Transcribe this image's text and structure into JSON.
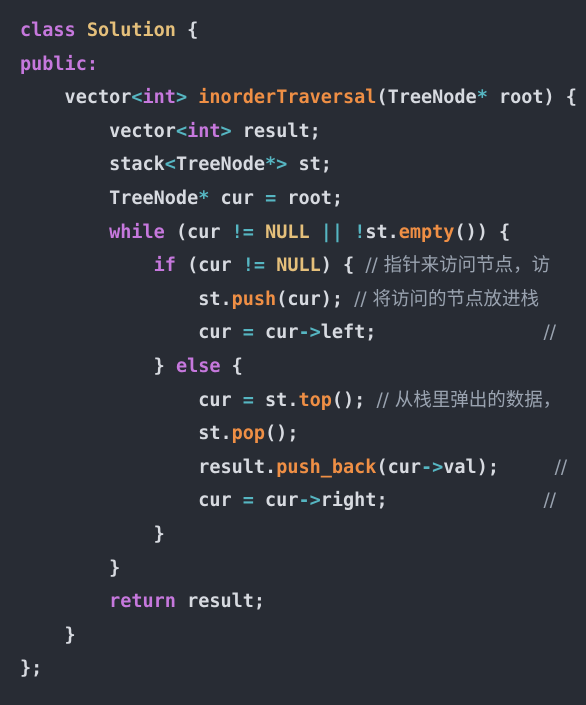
{
  "code_lines": [
    [
      {
        "t": "class ",
        "c": "kw"
      },
      {
        "t": "Solution",
        "c": "ty"
      },
      {
        "t": " {",
        "c": "pl"
      }
    ],
    [
      {
        "t": "public:",
        "c": "kw"
      }
    ],
    [
      {
        "t": "    vector",
        "c": "pl"
      },
      {
        "t": "<",
        "c": "op"
      },
      {
        "t": "int",
        "c": "kw"
      },
      {
        "t": ">",
        "c": "op"
      },
      {
        "t": " ",
        "c": "pl"
      },
      {
        "t": "inorderTraversal",
        "c": "fn"
      },
      {
        "t": "(TreeNode",
        "c": "pl"
      },
      {
        "t": "*",
        "c": "op"
      },
      {
        "t": " root) {",
        "c": "pl"
      }
    ],
    [
      {
        "t": "        vector",
        "c": "pl"
      },
      {
        "t": "<",
        "c": "op"
      },
      {
        "t": "int",
        "c": "kw"
      },
      {
        "t": ">",
        "c": "op"
      },
      {
        "t": " result;",
        "c": "pl"
      }
    ],
    [
      {
        "t": "        stack",
        "c": "pl"
      },
      {
        "t": "<",
        "c": "op"
      },
      {
        "t": "TreeNode",
        "c": "pl"
      },
      {
        "t": "*>",
        "c": "op"
      },
      {
        "t": " st;",
        "c": "pl"
      }
    ],
    [
      {
        "t": "        TreeNode",
        "c": "pl"
      },
      {
        "t": "*",
        "c": "op"
      },
      {
        "t": " cur ",
        "c": "pl"
      },
      {
        "t": "=",
        "c": "op"
      },
      {
        "t": " root;",
        "c": "pl"
      }
    ],
    [
      {
        "t": "        ",
        "c": "pl"
      },
      {
        "t": "while",
        "c": "kw"
      },
      {
        "t": " (cur ",
        "c": "pl"
      },
      {
        "t": "!=",
        "c": "op"
      },
      {
        "t": " ",
        "c": "pl"
      },
      {
        "t": "NULL",
        "c": "nul"
      },
      {
        "t": " ",
        "c": "pl"
      },
      {
        "t": "||",
        "c": "op"
      },
      {
        "t": " ",
        "c": "pl"
      },
      {
        "t": "!",
        "c": "op"
      },
      {
        "t": "st.",
        "c": "pl"
      },
      {
        "t": "empty",
        "c": "fn"
      },
      {
        "t": "()) {",
        "c": "pl"
      }
    ],
    [
      {
        "t": "            ",
        "c": "pl"
      },
      {
        "t": "if",
        "c": "kw"
      },
      {
        "t": " (cur ",
        "c": "pl"
      },
      {
        "t": "!=",
        "c": "op"
      },
      {
        "t": " ",
        "c": "pl"
      },
      {
        "t": "NULL",
        "c": "nul"
      },
      {
        "t": ") { ",
        "c": "pl"
      },
      {
        "t": "// 指针来访问节点，访",
        "c": "cm"
      }
    ],
    [
      {
        "t": "                st.",
        "c": "pl"
      },
      {
        "t": "push",
        "c": "fn"
      },
      {
        "t": "(cur); ",
        "c": "pl"
      },
      {
        "t": "// 将访问的节点放进栈",
        "c": "cm"
      }
    ],
    [
      {
        "t": "                cur ",
        "c": "pl"
      },
      {
        "t": "=",
        "c": "op"
      },
      {
        "t": " cur",
        "c": "pl"
      },
      {
        "t": "->",
        "c": "op"
      },
      {
        "t": "left;               ",
        "c": "pl"
      },
      {
        "t": "//",
        "c": "cm"
      }
    ],
    [
      {
        "t": "            } ",
        "c": "pl"
      },
      {
        "t": "else",
        "c": "kw"
      },
      {
        "t": " {",
        "c": "pl"
      }
    ],
    [
      {
        "t": "                cur ",
        "c": "pl"
      },
      {
        "t": "=",
        "c": "op"
      },
      {
        "t": " st.",
        "c": "pl"
      },
      {
        "t": "top",
        "c": "fn"
      },
      {
        "t": "(); ",
        "c": "pl"
      },
      {
        "t": "// 从栈里弹出的数据，",
        "c": "cm"
      }
    ],
    [
      {
        "t": "                st.",
        "c": "pl"
      },
      {
        "t": "pop",
        "c": "fn"
      },
      {
        "t": "();",
        "c": "pl"
      }
    ],
    [
      {
        "t": "                result.",
        "c": "pl"
      },
      {
        "t": "push_back",
        "c": "fn"
      },
      {
        "t": "(cur",
        "c": "pl"
      },
      {
        "t": "->",
        "c": "op"
      },
      {
        "t": "val);     ",
        "c": "pl"
      },
      {
        "t": "//",
        "c": "cm"
      }
    ],
    [
      {
        "t": "                cur ",
        "c": "pl"
      },
      {
        "t": "=",
        "c": "op"
      },
      {
        "t": " cur",
        "c": "pl"
      },
      {
        "t": "->",
        "c": "op"
      },
      {
        "t": "right;              ",
        "c": "pl"
      },
      {
        "t": "//",
        "c": "cm"
      }
    ],
    [
      {
        "t": "            }",
        "c": "pl"
      }
    ],
    [
      {
        "t": "        }",
        "c": "pl"
      }
    ],
    [
      {
        "t": "        ",
        "c": "pl"
      },
      {
        "t": "return",
        "c": "kw"
      },
      {
        "t": " result;",
        "c": "pl"
      }
    ],
    [
      {
        "t": "    }",
        "c": "pl"
      }
    ],
    [
      {
        "t": "};",
        "c": "pl"
      }
    ]
  ],
  "colors": {
    "background": "#282c34",
    "keyword": "#c678dd",
    "type": "#e5c07b",
    "function": "#ef8f45",
    "operator": "#56b6c2",
    "plain": "#d7dae0",
    "comment": "#9aa3b0"
  }
}
